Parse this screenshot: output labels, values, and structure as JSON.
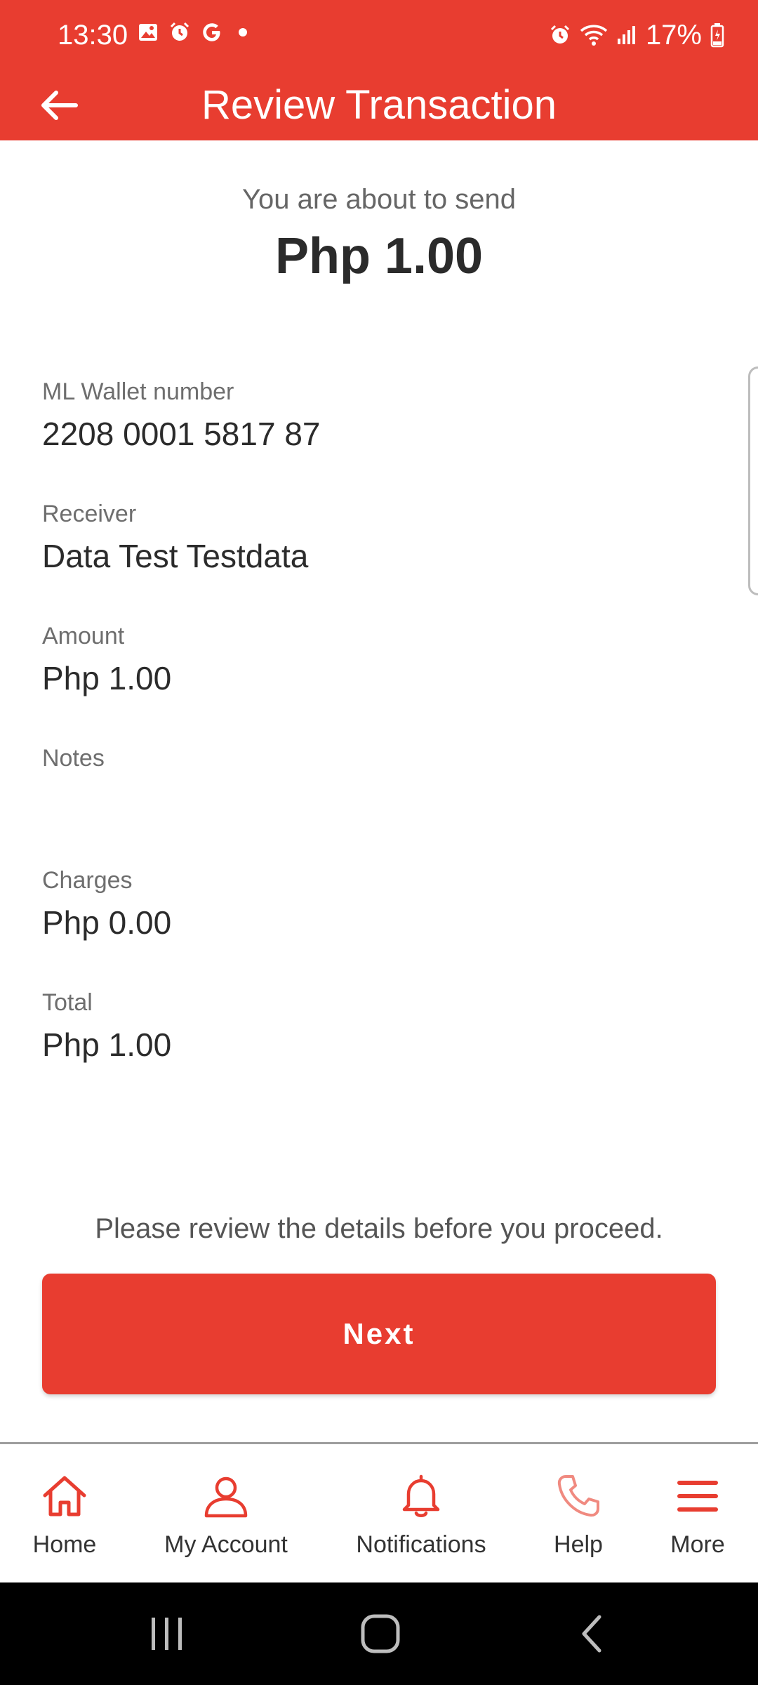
{
  "status_bar": {
    "time": "13:30",
    "battery": "17%",
    "left_icons": [
      "gallery-icon",
      "alarm-icon",
      "google-icon",
      "dot-icon"
    ],
    "right_icons": [
      "alarm-icon",
      "wifi-icon",
      "signal-icon",
      "battery-icon"
    ]
  },
  "header": {
    "title": "Review Transaction",
    "back_icon": "arrow-left-icon"
  },
  "summary": {
    "caption": "You are about to send",
    "amount": "Php 1.00"
  },
  "details": [
    {
      "label": "ML Wallet number",
      "value": "2208 0001 5817 87"
    },
    {
      "label": "Receiver",
      "value": "Data Test Testdata"
    },
    {
      "label": "Amount",
      "value": "Php 1.00"
    },
    {
      "label": "Notes",
      "value": ""
    },
    {
      "label": "Charges",
      "value": "Php 0.00"
    },
    {
      "label": "Total",
      "value": "Php 1.00"
    }
  ],
  "footer": {
    "note": "Please review the details before you proceed.",
    "next_label": "Next"
  },
  "bottom_nav": [
    {
      "label": "Home",
      "icon": "home-icon"
    },
    {
      "label": "My Account",
      "icon": "user-icon"
    },
    {
      "label": "Notifications",
      "icon": "bell-icon"
    },
    {
      "label": "Help",
      "icon": "phone-icon"
    },
    {
      "label": "More",
      "icon": "menu-icon"
    }
  ],
  "colors": {
    "brand": "#e83d30",
    "help_icon": "#f08a80"
  }
}
